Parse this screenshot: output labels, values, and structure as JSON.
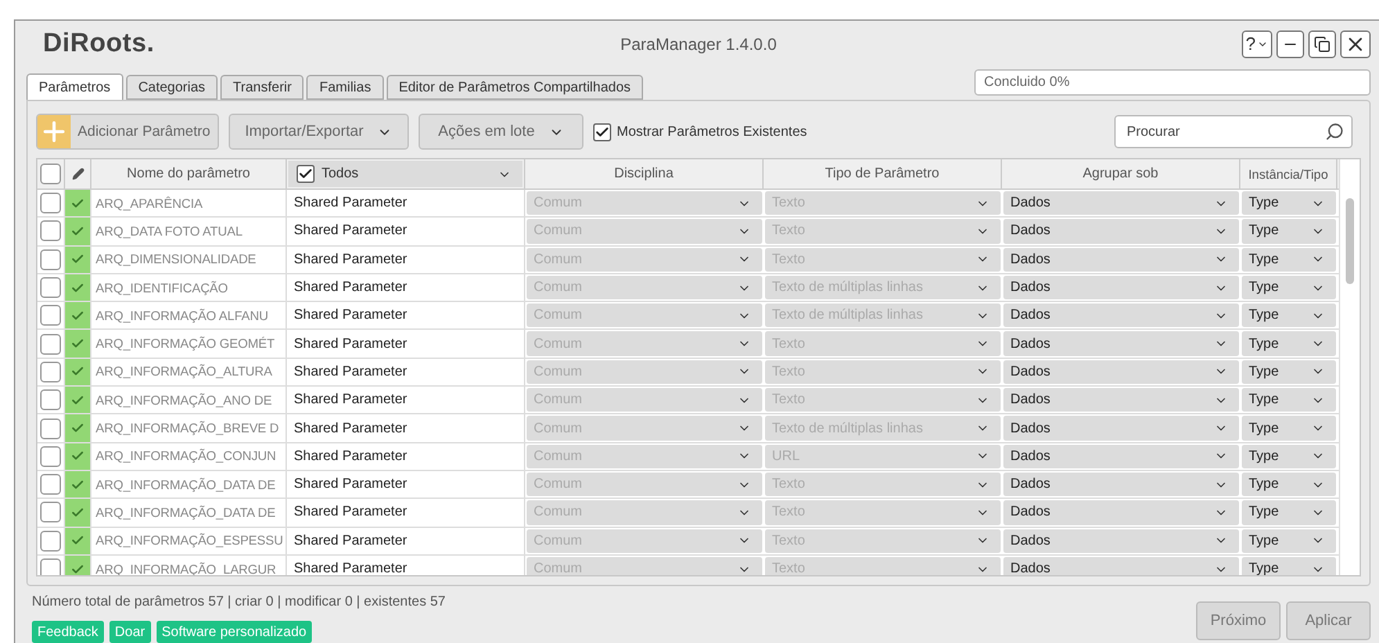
{
  "window": {
    "logo": "DiRoots.",
    "title": "ParaManager 1.4.0.0",
    "help": "?"
  },
  "tabs": [
    {
      "label": "Parâmetros",
      "selected": true
    },
    {
      "label": "Categorias",
      "selected": false
    },
    {
      "label": "Transferir",
      "selected": false
    },
    {
      "label": "Familias",
      "selected": false
    },
    {
      "label": "Editor de Parâmetros Compartilhados",
      "selected": false
    }
  ],
  "progress": {
    "label": "Concluido 0%"
  },
  "toolbar": {
    "add_button": "Adicionar Parâmetro",
    "import_export": "Importar/Exportar",
    "batch_actions": "Ações em lote",
    "show_existing": {
      "label": "Mostrar Parâmetros Existentes",
      "checked": true
    },
    "search": {
      "placeholder": "Procurar"
    }
  },
  "table": {
    "select_all": {
      "checked": false
    },
    "columns": {
      "name": "Nome do parâmetro",
      "source_filter": {
        "label": "Todos",
        "checked": true
      },
      "discipline": "Disciplina",
      "param_type": "Tipo de Parâmetro",
      "group": "Agrupar sob",
      "instance": "Instância/Tipo"
    },
    "rows": [
      {
        "checked": false,
        "exists": true,
        "name": "ARQ_APARÊNCIA",
        "source": "Shared Parameter",
        "discipline": "Comum",
        "param_type": "Texto",
        "group": "Dados",
        "instance": "Type"
      },
      {
        "checked": false,
        "exists": true,
        "name": "ARQ_DATA FOTO ATUAL",
        "source": "Shared Parameter",
        "discipline": "Comum",
        "param_type": "Texto",
        "group": "Dados",
        "instance": "Type"
      },
      {
        "checked": false,
        "exists": true,
        "name": "ARQ_DIMENSIONALIDADE",
        "source": "Shared Parameter",
        "discipline": "Comum",
        "param_type": "Texto",
        "group": "Dados",
        "instance": "Type"
      },
      {
        "checked": false,
        "exists": true,
        "name": "ARQ_IDENTIFICAÇÃO",
        "source": "Shared Parameter",
        "discipline": "Comum",
        "param_type": "Texto de múltiplas linhas",
        "group": "Dados",
        "instance": "Type"
      },
      {
        "checked": false,
        "exists": true,
        "name": "ARQ_INFORMAÇÃO ALFANU",
        "source": "Shared Parameter",
        "discipline": "Comum",
        "param_type": "Texto de múltiplas linhas",
        "group": "Dados",
        "instance": "Type"
      },
      {
        "checked": false,
        "exists": true,
        "name": "ARQ_INFORMAÇÃO GEOMÉT",
        "source": "Shared Parameter",
        "discipline": "Comum",
        "param_type": "Texto",
        "group": "Dados",
        "instance": "Type"
      },
      {
        "checked": false,
        "exists": true,
        "name": "ARQ_INFORMAÇÃO_ALTURA",
        "source": "Shared Parameter",
        "discipline": "Comum",
        "param_type": "Texto",
        "group": "Dados",
        "instance": "Type"
      },
      {
        "checked": false,
        "exists": true,
        "name": "ARQ_INFORMAÇÃO_ANO DE",
        "source": "Shared Parameter",
        "discipline": "Comum",
        "param_type": "Texto",
        "group": "Dados",
        "instance": "Type"
      },
      {
        "checked": false,
        "exists": true,
        "name": "ARQ_INFORMAÇÃO_BREVE D",
        "source": "Shared Parameter",
        "discipline": "Comum",
        "param_type": "Texto de múltiplas linhas",
        "group": "Dados",
        "instance": "Type"
      },
      {
        "checked": false,
        "exists": true,
        "name": "ARQ_INFORMAÇÃO_CONJUN",
        "source": "Shared Parameter",
        "discipline": "Comum",
        "param_type": "URL",
        "group": "Dados",
        "instance": "Type"
      },
      {
        "checked": false,
        "exists": true,
        "name": "ARQ_INFORMAÇÃO_DATA DE",
        "source": "Shared Parameter",
        "discipline": "Comum",
        "param_type": "Texto",
        "group": "Dados",
        "instance": "Type"
      },
      {
        "checked": false,
        "exists": true,
        "name": "ARQ_INFORMAÇÃO_DATA DE",
        "source": "Shared Parameter",
        "discipline": "Comum",
        "param_type": "Texto",
        "group": "Dados",
        "instance": "Type"
      },
      {
        "checked": false,
        "exists": true,
        "name": "ARQ_INFORMAÇÃO_ESPESSU",
        "source": "Shared Parameter",
        "discipline": "Comum",
        "param_type": "Texto",
        "group": "Dados",
        "instance": "Type"
      },
      {
        "checked": false,
        "exists": true,
        "name": "ARQ_INFORMAÇÃO_LARGUR",
        "source": "Shared Parameter",
        "discipline": "Comum",
        "param_type": "Texto",
        "group": "Dados",
        "instance": "Type"
      }
    ]
  },
  "status": "Número total de parâmetros 57 | criar 0 | modificar 0 | existentes 57",
  "links": [
    "Feedback",
    "Doar",
    "Software personalizado"
  ],
  "buttons": [
    "Próximo",
    "Aplicar"
  ]
}
